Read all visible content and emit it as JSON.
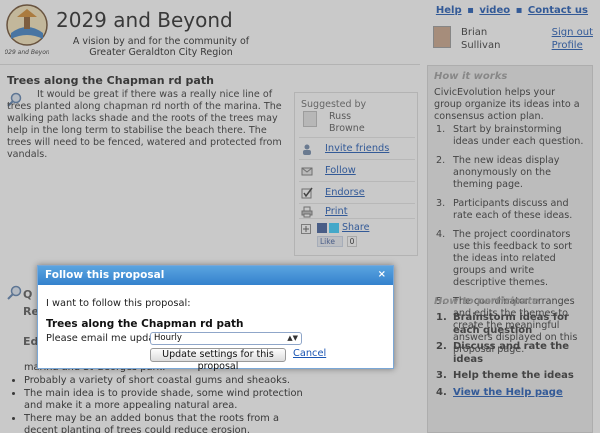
{
  "header": {
    "site_title": "2029 and Beyond",
    "site_subtitle": "A vision by and for the community of Greater Geraldton City Region",
    "logo_text": "2029 and Beyond",
    "links": {
      "help": "Help",
      "video": "video",
      "contact": "Contact us",
      "separator": "▪"
    },
    "user": {
      "first": "Brian",
      "last": "Sullivan",
      "sign_out": "Sign out",
      "profile": "Profile"
    }
  },
  "proposal": {
    "title": "Trees along the Chapman rd path",
    "body": "It would be great if there was a really nice line of trees planted along chapman rd north of the marina. The walking path lacks shade and the roots of the trees may help in the long term to stabilise the beach there. The trees will need to be fenced, watered and protected from vandals."
  },
  "actions": {
    "suggested_by": "Suggested by",
    "suggester_first": "Russ",
    "suggester_last": "Browne",
    "invite": "Invite friends",
    "follow": "Follow",
    "endorse": "Endorse",
    "print": "Print",
    "share": "Share",
    "like": "Like",
    "like_count": "0"
  },
  "section2": {
    "frag_q": "Q",
    "frag_re": "Re",
    "frag_ed": "Ed"
  },
  "bullets": [
    "marina and St Georges park.",
    "Probably a variety of short coastal gums and sheaoks.",
    "The main idea is to provide shade, some wind protection and make it a more appealing natural area.",
    "There may be an added bonus that the roots from a decent planting of trees could reduce erosion."
  ],
  "sidebar": {
    "how_it_works_head": "How it works",
    "intro": "CivicEvolution helps your group organize its ideas into a consensus action plan.",
    "steps": [
      "Start by brainstorming ideas under each question.",
      "The new ideas display anonymously on the theming page.",
      "Participants discuss and rate each of these ideas.",
      "The project coordinators use this feedback to sort the ideas into related groups and write descriptive themes.",
      "The coordinator arranges and edits the themes to create the meaningful answers displayed on this proposal page."
    ],
    "participate_head": "How to participate",
    "participate": [
      "Brainstorm ideas for each question",
      "Discuss and rate the ideas",
      "Help theme the ideas",
      "View the Help page"
    ]
  },
  "dialog": {
    "title": "Follow this proposal",
    "close": "×",
    "intro": "I want to follow this proposal:",
    "proposal_title": "Trees along the Chapman rd path",
    "email_label": "Please email me updates",
    "frequency": "Hourly",
    "update_button": "Update settings for this proposal",
    "cancel": "Cancel"
  },
  "colors": {
    "dialog_bar": "#3481cd",
    "link": "#1a55b3",
    "sidebar_bg": "#ebebeb"
  }
}
